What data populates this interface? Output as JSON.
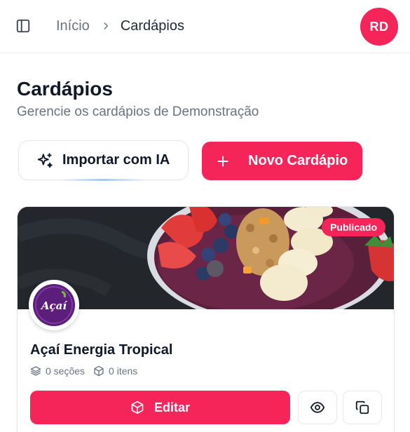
{
  "header": {
    "breadcrumb": {
      "home": "Início",
      "current": "Cardápios"
    },
    "user_initials": "RD"
  },
  "page": {
    "title": "Cardápios",
    "subtitle": "Gerencie os cardápios de Demonstração"
  },
  "actions": {
    "import_label": "Importar com IA",
    "new_label": "Novo Cardápio"
  },
  "menu_card": {
    "status": "Publicado",
    "logo_text": "Açaí",
    "name": "Açaí Energia Tropical",
    "sections": "0 seções",
    "items": "0 itens",
    "edit_label": "Editar"
  },
  "colors": {
    "accent": "#f5255a",
    "text_primary": "#111827",
    "text_muted": "#6b7280",
    "border": "#e5e7eb"
  },
  "icons": {
    "sidebar": "sidebar-toggle-icon",
    "breadcrumb_separator": "chevron-right-icon",
    "import": "sparkles-icon",
    "new": "plus-icon",
    "sections": "layers-icon",
    "items": "box-icon",
    "edit": "box-icon",
    "view": "eye-icon",
    "duplicate": "copy-icon"
  }
}
